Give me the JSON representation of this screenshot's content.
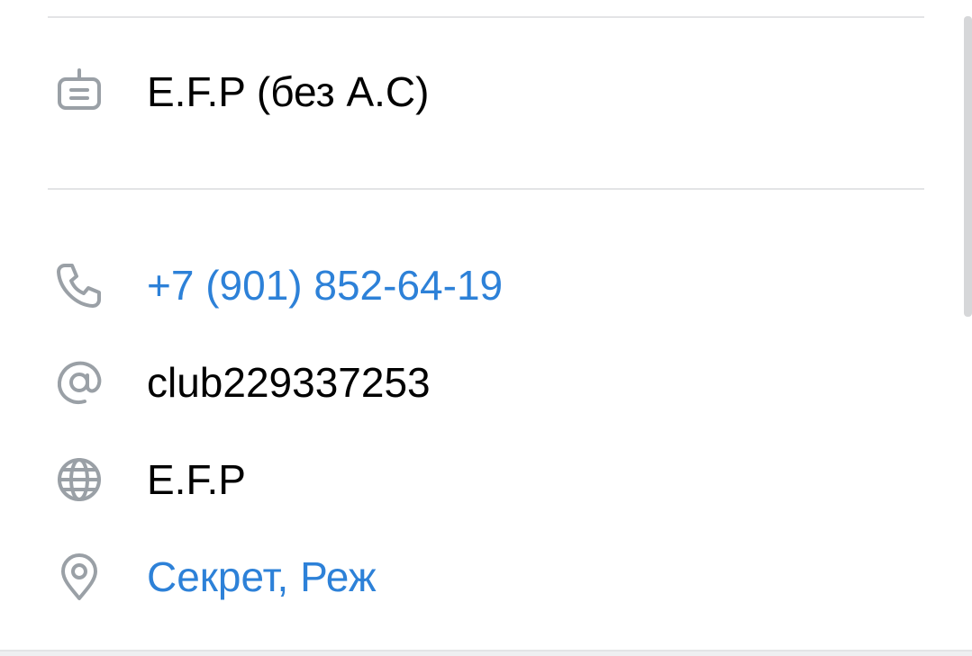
{
  "community_info": {
    "description": {
      "icon": "info-card-icon",
      "text": "E.F.P (без А.С)"
    },
    "phone": {
      "icon": "phone-icon",
      "text": "+7 (901) 852-64-19"
    },
    "short_address": {
      "icon": "at-sign-icon",
      "text": "club229337253"
    },
    "website": {
      "icon": "globe-icon",
      "text": "E.F.P"
    },
    "location": {
      "icon": "location-pin-icon",
      "text": "Секрет, Реж"
    }
  },
  "colors": {
    "link": "#2d81d8",
    "icon": "#9aa0a6",
    "text": "#000000",
    "divider": "#e3e4e6"
  }
}
